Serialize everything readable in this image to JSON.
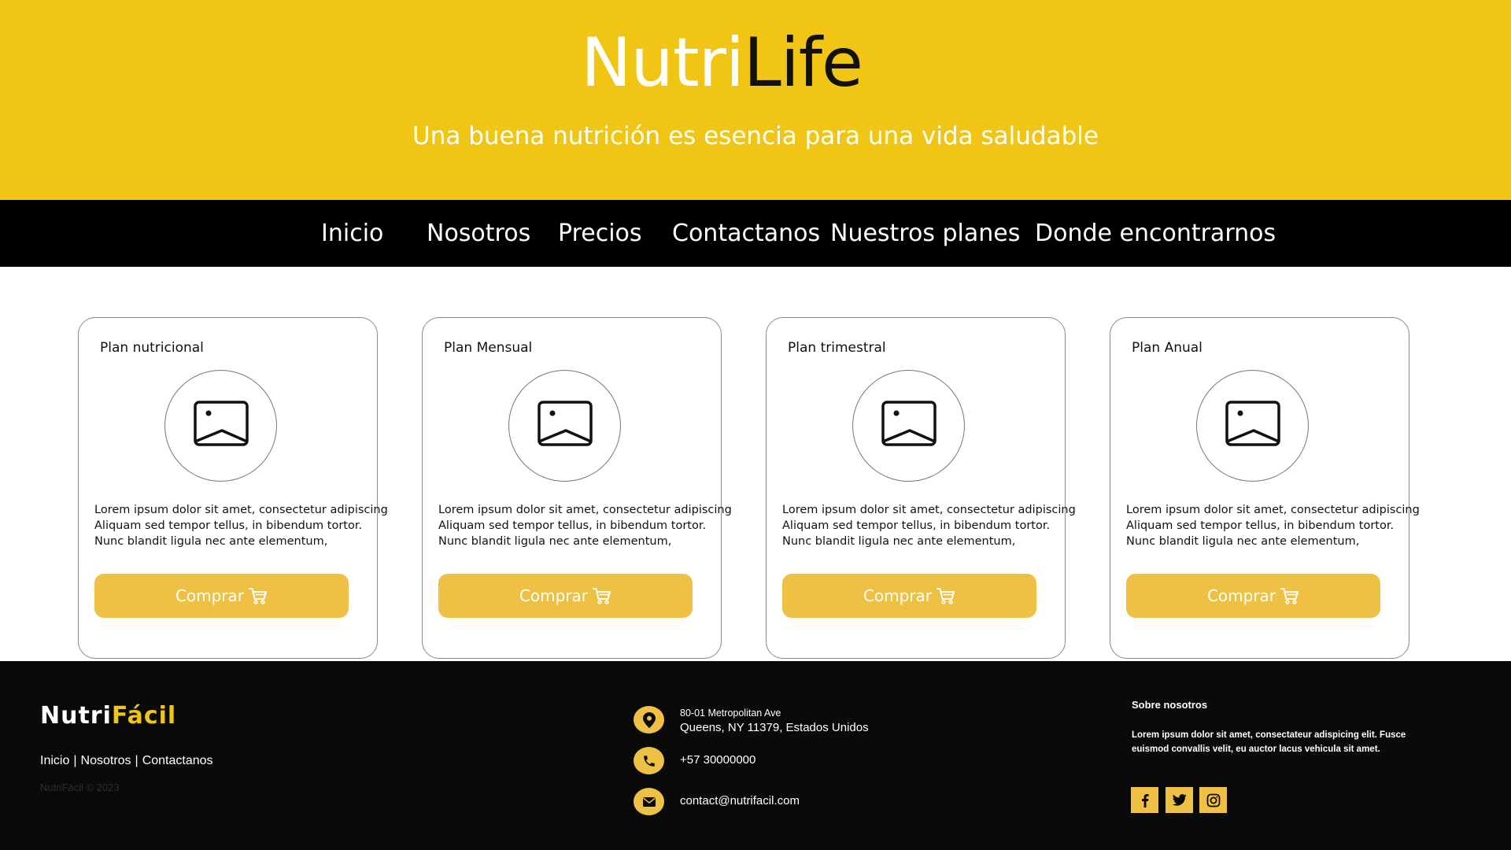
{
  "header": {
    "brand_part1": "Nutri",
    "brand_part2": "Life",
    "tagline": "Una buena nutrición es esencia para una vida saludable",
    "background_color": "#f0c514"
  },
  "nav": {
    "items": [
      {
        "label": "Inicio"
      },
      {
        "label": "Nosotros"
      },
      {
        "label": "Precios"
      },
      {
        "label": "Contactanos"
      },
      {
        "label": "Nuestros planes"
      },
      {
        "label": "Donde encontrarnos"
      }
    ]
  },
  "plans": [
    {
      "title": "Plan nutricional",
      "icon": "image-placeholder-icon",
      "description": [
        "Lorem ipsum dolor sit amet, consectetur adipiscing",
        "Aliquam sed tempor tellus, in bibendum tortor.",
        "Nunc blandit ligula nec ante elementum,"
      ],
      "button_label": "Comprar"
    },
    {
      "title": "Plan Mensual",
      "icon": "image-placeholder-icon",
      "description": [
        "Lorem ipsum dolor sit amet, consectetur adipiscing",
        "Aliquam sed tempor tellus, in bibendum tortor.",
        "Nunc blandit ligula nec ante elementum,"
      ],
      "button_label": "Comprar"
    },
    {
      "title": "Plan trimestral",
      "icon": "image-placeholder-icon",
      "description": [
        "Lorem ipsum dolor sit amet, consectetur adipiscing",
        "Aliquam sed tempor tellus, in bibendum tortor.",
        "Nunc blandit ligula nec ante elementum,"
      ],
      "button_label": "Comprar"
    },
    {
      "title": "Plan Anual",
      "icon": "image-placeholder-icon",
      "description": [
        "Lorem ipsum dolor sit amet, consectetur adipiscing",
        "Aliquam sed tempor tellus, in bibendum tortor.",
        "Nunc blandit ligula nec ante elementum,"
      ],
      "button_label": "Comprar"
    }
  ],
  "footer": {
    "logo_part1": "Nutri",
    "logo_part2": "Fácil",
    "links": [
      {
        "label": "Inicio"
      },
      {
        "label": "Nosotros"
      },
      {
        "label": "Contactanos"
      }
    ],
    "link_separator": "|",
    "copyright": "NutriFácil © 2023",
    "address_line1": "80-01 Metropolitan Ave",
    "address_line2": "Queens, NY 11379, Estados Unidos",
    "phone": "+57 30000000",
    "email": "contact@nutrifacil.com",
    "about_title": "Sobre nosotros",
    "about_text": "Lorem ipsum dolor sit amet, consectateur adispicing elit. Fusce euismod convallis velit, eu auctor lacus vehicula sit amet.",
    "social": [
      {
        "icon": "facebook-icon"
      },
      {
        "icon": "twitter-icon"
      },
      {
        "icon": "instagram-icon"
      }
    ],
    "accent_color": "#eec043"
  }
}
